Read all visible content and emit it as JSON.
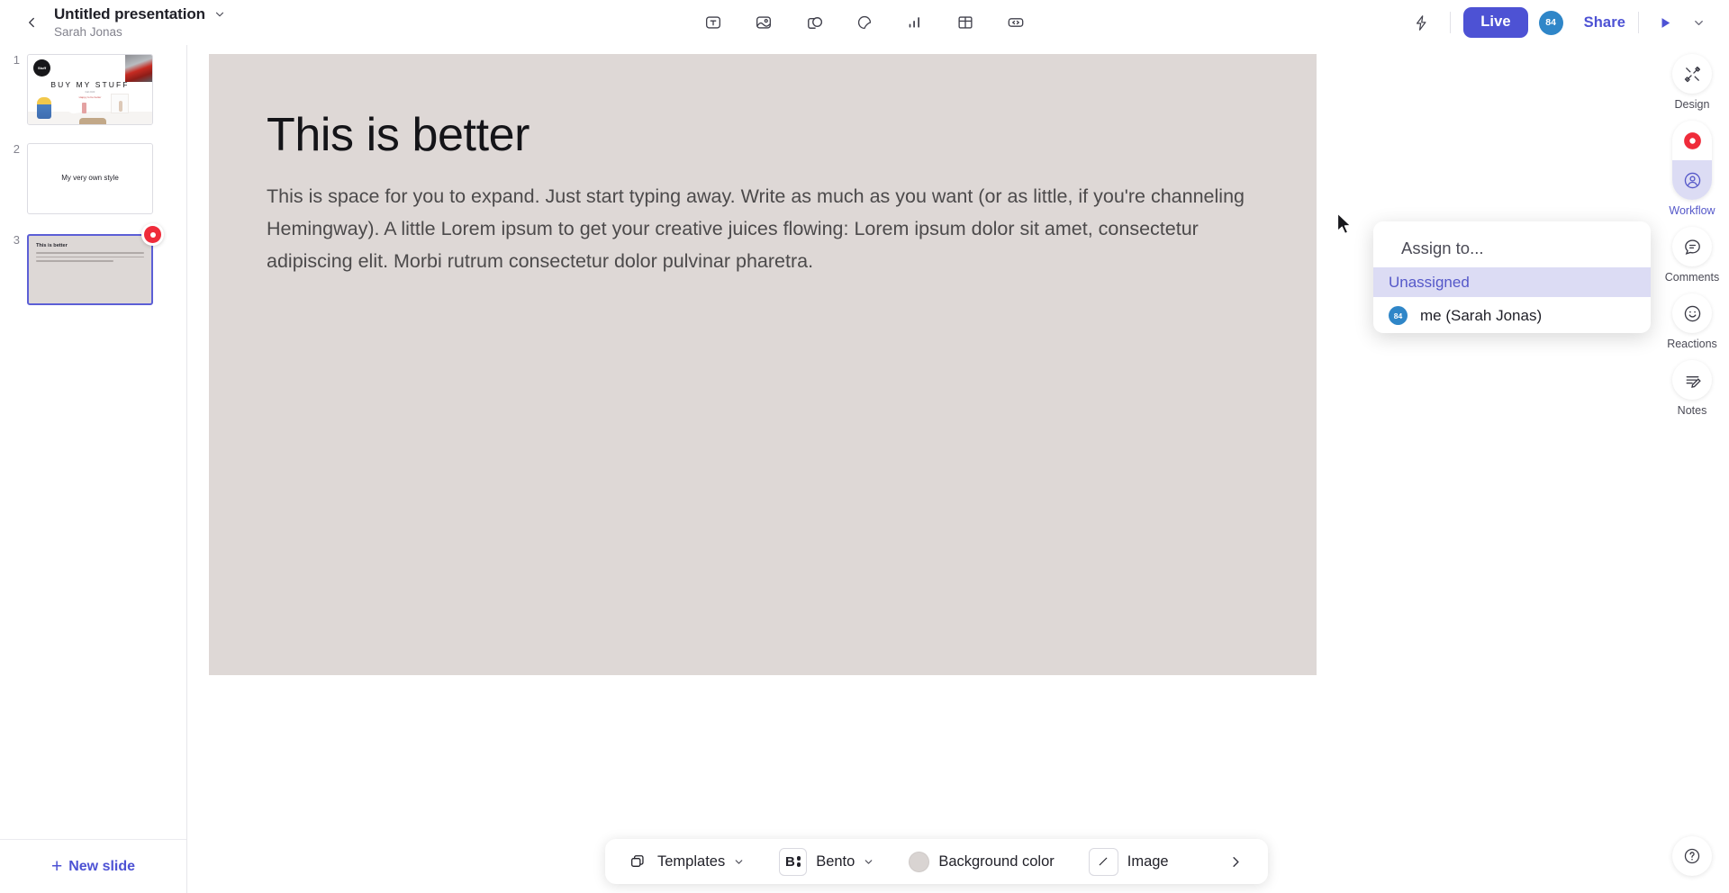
{
  "header": {
    "back_icon": "chevron-left-icon",
    "doc_title": "Untitled presentation",
    "doc_author": "Sarah Jonas",
    "title_caret_icon": "chevron-down-icon",
    "tools": [
      {
        "name": "text-tool",
        "icon": "text-box-icon"
      },
      {
        "name": "image-tool",
        "icon": "image-icon"
      },
      {
        "name": "shapes-tool",
        "icon": "shapes-icon"
      },
      {
        "name": "sticker-tool",
        "icon": "sticker-icon"
      },
      {
        "name": "chart-tool",
        "icon": "bar-chart-icon"
      },
      {
        "name": "table-tool",
        "icon": "table-icon"
      },
      {
        "name": "embed-tool",
        "icon": "code-embed-icon"
      }
    ],
    "bolt_icon": "lightning-bolt-icon",
    "live_label": "Live",
    "avatar_label": "84",
    "share_label": "Share",
    "present_icon": "play-triangle-icon",
    "more_icon": "chevron-down-icon",
    "accent_color": "#4d52d4",
    "avatar_color": "#2f86c8"
  },
  "sidebar": {
    "slides": [
      {
        "number": "1",
        "logo_text": "Stuff",
        "title": "BUY MY STUFF",
        "subtitle": "Fall 2023",
        "subtitle2": "Happy to be better",
        "selected": false,
        "has_record_badge": false
      },
      {
        "number": "2",
        "title": "My very own style",
        "selected": false,
        "has_record_badge": false
      },
      {
        "number": "3",
        "title": "This is better",
        "selected": true,
        "has_record_badge": true
      }
    ],
    "new_slide_label": "New slide",
    "new_slide_plus": "+"
  },
  "canvas": {
    "heading": "This is better",
    "body": "This is space for you to expand. Just start typing away. Write as much as you want (or as little, if you're channeling Hemingway). A little Lorem ipsum to get your creative juices flowing: Lorem ipsum dolor sit amet, consectetur adipiscing elit. Morbi rutrum consectetur dolor pulvinar pharetra.",
    "background_color": "#ded8d6"
  },
  "right_rail": {
    "items": [
      {
        "name": "design",
        "label": "Design",
        "icon": "design-pencil-ruler-icon",
        "active": false
      },
      {
        "name": "record",
        "label": "",
        "icon": "record-dot-icon",
        "active": false
      },
      {
        "name": "workflow",
        "label": "Workflow",
        "icon": "person-circle-icon",
        "active": true
      },
      {
        "name": "comments",
        "label": "Comments",
        "icon": "comment-bubble-icon",
        "active": false
      },
      {
        "name": "reactions",
        "label": "Reactions",
        "icon": "smiley-face-icon",
        "active": false
      },
      {
        "name": "notes",
        "label": "Notes",
        "icon": "notes-pencil-icon",
        "active": false
      }
    ],
    "help_icon": "question-mark-circle-icon",
    "active_color": "#5558c9",
    "record_color": "#ef2b3a"
  },
  "assign_popup": {
    "title": "Assign to...",
    "options": [
      {
        "label": "Unassigned",
        "selected": true,
        "avatar": ""
      },
      {
        "label": "me (Sarah Jonas)",
        "selected": false,
        "avatar": "84"
      }
    ],
    "highlight_color": "#dcdcf4"
  },
  "bottom_bar": {
    "templates_label": "Templates",
    "templates_icon": "copy-stack-icon",
    "bento_label": "Bento",
    "bento_icon": "bento-brand-icon",
    "background_color_label": "Background color",
    "background_swatch": "#d9d4d2",
    "image_label": "Image",
    "image_icon": "slash-box-icon",
    "next_icon": "chevron-right-icon"
  }
}
